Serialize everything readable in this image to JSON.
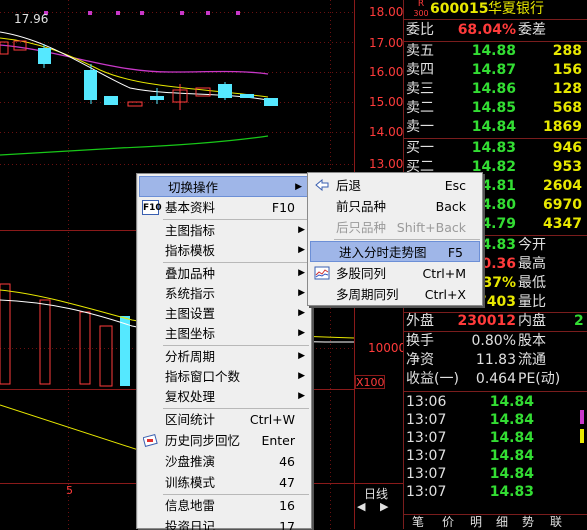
{
  "chart": {
    "price_readout": "17.96",
    "price_axis": [
      "18.00",
      "17.00",
      "16.00",
      "15.00",
      "14.00",
      "13.00"
    ],
    "volume_axis": "10000",
    "multiplier": "X100",
    "period_marker": "5",
    "period_label": "日线",
    "tabs": [
      "笔",
      "价",
      "明",
      "细",
      "势",
      "联"
    ]
  },
  "quote": {
    "badge_top": "R",
    "badge_bottom": "300",
    "code": "600015",
    "name": "华夏银行",
    "weibi_label": "委比",
    "weibi_value": "68.04%",
    "weicha_label": "委差",
    "sell": [
      {
        "label": "卖五",
        "price": "14.88",
        "vol": "288"
      },
      {
        "label": "卖四",
        "price": "14.87",
        "vol": "156"
      },
      {
        "label": "卖三",
        "price": "14.86",
        "vol": "128"
      },
      {
        "label": "卖二",
        "price": "14.85",
        "vol": "568"
      },
      {
        "label": "卖一",
        "price": "14.84",
        "vol": "1869"
      }
    ],
    "buy": [
      {
        "label": "买一",
        "price": "14.83",
        "vol": "946"
      },
      {
        "label": "买二",
        "price": "14.82",
        "vol": "953"
      },
      {
        "label": "",
        "price": "14.81",
        "vol": "2604"
      },
      {
        "label": "",
        "price": "14.80",
        "vol": "6970"
      },
      {
        "label": "",
        "price": "14.79",
        "vol": "4347"
      }
    ],
    "stats_left": [
      "4.83",
      "0.36",
      "37%",
      "7403"
    ],
    "stats_right": [
      "今开",
      "最高",
      "最低",
      "量比"
    ],
    "waipan_label": "外盘",
    "waipan_value": "230012",
    "neipan_label": "内盘",
    "neipan_value": "2",
    "huanshou_label": "换手",
    "huanshou_value": "0.80%",
    "guben_label": "股本",
    "jingzi_label": "净资",
    "jingzi_value": "11.83",
    "liutong_label": "流通",
    "shouyi_label": "收益(一)",
    "shouyi_value": "0.464",
    "pe_label": "PE(动)"
  },
  "ticks": [
    {
      "time": "13:06",
      "price": "14.84"
    },
    {
      "time": "13:07",
      "price": "14.84"
    },
    {
      "time": "13:07",
      "price": "14.84"
    },
    {
      "time": "13:07",
      "price": "14.84"
    },
    {
      "time": "13:07",
      "price": "14.84"
    },
    {
      "time": "13:07",
      "price": "14.83"
    }
  ],
  "menu": {
    "items": [
      {
        "label": "切换操作",
        "key": "",
        "arrow": "▶",
        "icon": "",
        "hl": true
      },
      {
        "label": "基本资料",
        "key": "F10",
        "arrow": "",
        "icon": "F10"
      },
      {
        "label": "主图指标",
        "key": "",
        "arrow": "▶",
        "icon": ""
      },
      {
        "label": "指标模板",
        "key": "",
        "arrow": "▶",
        "icon": ""
      },
      {
        "label": "叠加品种",
        "key": "",
        "arrow": "▶",
        "icon": ""
      },
      {
        "label": "系统指示",
        "key": "",
        "arrow": "▶",
        "icon": ""
      },
      {
        "label": "主图设置",
        "key": "",
        "arrow": "▶",
        "icon": ""
      },
      {
        "label": "主图坐标",
        "key": "",
        "arrow": "▶",
        "icon": ""
      },
      {
        "label": "分析周期",
        "key": "",
        "arrow": "▶",
        "icon": ""
      },
      {
        "label": "指标窗口个数",
        "key": "",
        "arrow": "▶",
        "icon": ""
      },
      {
        "label": "复权处理",
        "key": "",
        "arrow": "▶",
        "icon": ""
      },
      {
        "label": "区间统计",
        "key": "Ctrl+W",
        "arrow": "",
        "icon": ""
      },
      {
        "label": "历史同步回忆",
        "key": "Enter",
        "arrow": "",
        "icon": "card"
      },
      {
        "label": "沙盘推演",
        "key": "46",
        "arrow": "",
        "icon": ""
      },
      {
        "label": "训练模式",
        "key": "47",
        "arrow": "",
        "icon": ""
      },
      {
        "label": "信息地雷",
        "key": "16",
        "arrow": "",
        "icon": ""
      },
      {
        "label": "投资日记",
        "key": "17",
        "arrow": "",
        "icon": ""
      }
    ],
    "sub": [
      {
        "label": "后退",
        "key": "Esc",
        "icon": "back"
      },
      {
        "label": "前只品种",
        "key": "Back",
        "icon": ""
      },
      {
        "label": "后只品种",
        "key": "Shift+Back",
        "icon": "",
        "disabled": true
      },
      {
        "label": "进入分时走势图",
        "key": "F5",
        "icon": "",
        "hl": true
      },
      {
        "label": "多股同列",
        "key": "Ctrl+M",
        "icon": "multi"
      },
      {
        "label": "多周期同列",
        "key": "Ctrl+X",
        "icon": ""
      }
    ]
  }
}
